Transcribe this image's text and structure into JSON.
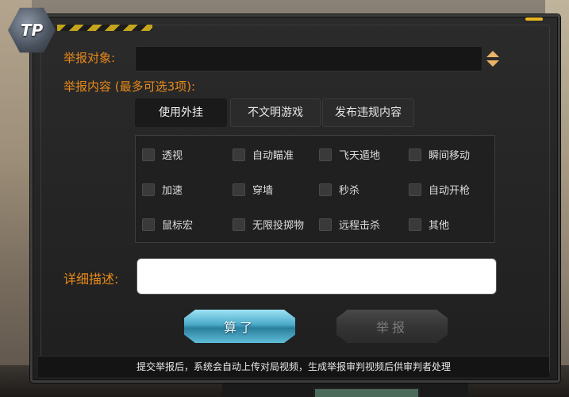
{
  "logo": {
    "text": "TP"
  },
  "form": {
    "target_label": "举报对象:",
    "content_label": "举报内容 (最多可选3项):",
    "description_label": "详细描述:",
    "target_value": "",
    "description_value": ""
  },
  "tabs": [
    {
      "label": "使用外挂",
      "active": true
    },
    {
      "label": "不文明游戏",
      "active": false
    },
    {
      "label": "发布违规内容",
      "active": false
    }
  ],
  "options": [
    {
      "label": "透视",
      "checked": false
    },
    {
      "label": "自动瞄准",
      "checked": false
    },
    {
      "label": "飞天遁地",
      "checked": false
    },
    {
      "label": "瞬间移动",
      "checked": false
    },
    {
      "label": "加速",
      "checked": false
    },
    {
      "label": "穿墙",
      "checked": false
    },
    {
      "label": "秒杀",
      "checked": false
    },
    {
      "label": "自动开枪",
      "checked": false
    },
    {
      "label": "鼠标宏",
      "checked": false
    },
    {
      "label": "无限投掷物",
      "checked": false
    },
    {
      "label": "远程击杀",
      "checked": false
    },
    {
      "label": "其他",
      "checked": false
    }
  ],
  "buttons": {
    "cancel_label": "算了",
    "report_label": "举报"
  },
  "footer_text": "提交举报后，系统会自动上传对局视频，生成举报审判视频后供审判者处理",
  "colors": {
    "label_orange": "#e88a1a",
    "accent_yellow": "#e8b523",
    "cancel_button": "#4aa9c8",
    "panel_bg": "#1f1f1f"
  }
}
